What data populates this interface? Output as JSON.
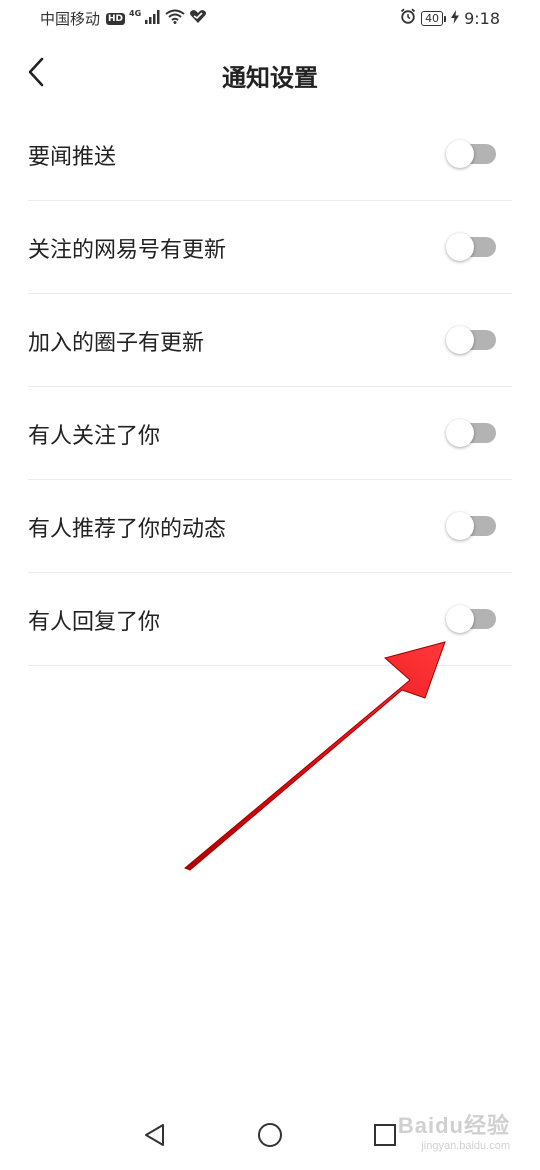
{
  "status_bar": {
    "carrier": "中国移动",
    "hd_badge": "HD",
    "network_type": "4G",
    "battery_level": "40",
    "time": "9:18",
    "icons": [
      "signal-icon",
      "wifi-icon",
      "alarm-icon",
      "charging-icon"
    ]
  },
  "header": {
    "title": "通知设置",
    "back_icon": "chevron-left-icon"
  },
  "settings": [
    {
      "label": "要闻推送",
      "enabled": false
    },
    {
      "label": "关注的网易号有更新",
      "enabled": false
    },
    {
      "label": "加入的圈子有更新",
      "enabled": false
    },
    {
      "label": "有人关注了你",
      "enabled": false
    },
    {
      "label": "有人推荐了你的动态",
      "enabled": false
    },
    {
      "label": "有人回复了你",
      "enabled": false
    }
  ],
  "annotation": {
    "type": "arrow",
    "color": "#e8101b",
    "points_to": "有人回复了你"
  },
  "nav_bar": {
    "icons": [
      "back-triangle-icon",
      "home-circle-icon",
      "recents-square-icon"
    ]
  },
  "watermark": {
    "text": "Baidu经验",
    "sub": "jingyan.baidu.com"
  },
  "colors": {
    "toggle_track_off": "#b3b3b3",
    "toggle_knob": "#ffffff",
    "divider": "#ececec",
    "text": "#222222"
  }
}
